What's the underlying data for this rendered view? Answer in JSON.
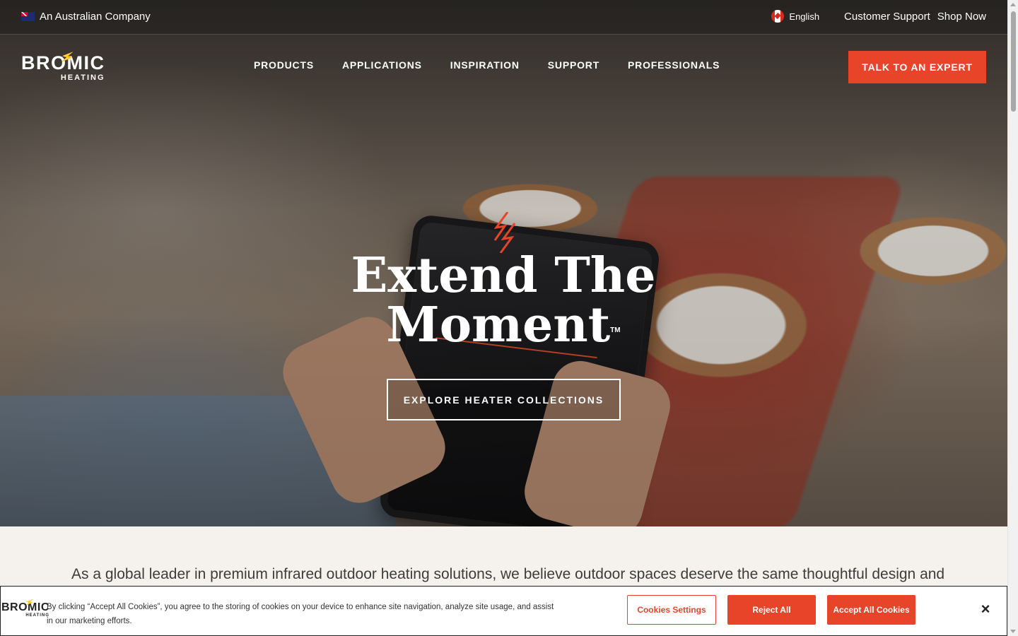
{
  "topbar": {
    "company": "An Australian Company",
    "language": "English",
    "customer_support": "Customer Support",
    "shop_now": "Shop Now"
  },
  "brand": {
    "name": "BROMIC",
    "sub": "HEATING"
  },
  "nav": {
    "items": [
      {
        "label": "PRODUCTS"
      },
      {
        "label": "APPLICATIONS"
      },
      {
        "label": "INSPIRATION"
      },
      {
        "label": "SUPPORT"
      },
      {
        "label": "PROFESSIONALS"
      }
    ],
    "cta": "TALK TO AN EXPERT"
  },
  "hero": {
    "line1": "Extend The",
    "line2": "Moment",
    "tm": "TM",
    "button": "EXPLORE HEATER COLLECTIONS"
  },
  "intro": {
    "text": "As a global leader in premium infrared outdoor heating solutions, we believe outdoor spaces deserve the same thoughtful design and"
  },
  "cookie": {
    "text": "By clicking “Accept All Cookies”, you agree to the storing of cookies on your device to enhance site navigation, analyze site usage, and assist in our marketing efforts.",
    "settings": "Cookies Settings",
    "reject": "Reject All",
    "accept": "Accept All Cookies",
    "close": "×"
  },
  "colors": {
    "accent": "#e8442a",
    "intro_bg": "#f5f2ee"
  }
}
